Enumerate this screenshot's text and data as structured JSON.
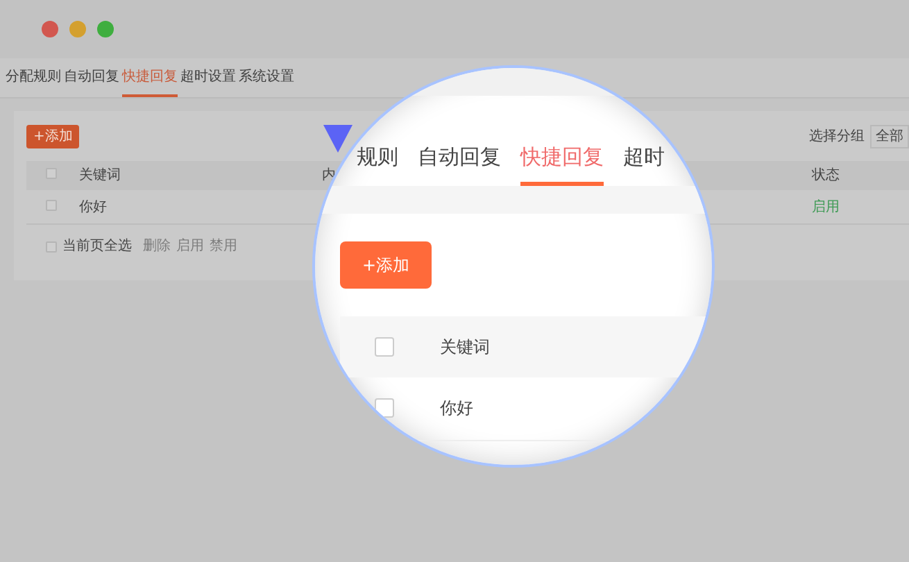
{
  "window": {
    "traffic_lights": [
      {
        "color": "#d2574f"
      },
      {
        "color": "#d4a02f"
      },
      {
        "color": "#3fae3f"
      }
    ]
  },
  "tabs": [
    {
      "label": "分配规则",
      "selected": false
    },
    {
      "label": "自动回复",
      "selected": false
    },
    {
      "label": "快捷回复",
      "selected": true
    },
    {
      "label": "超时设置",
      "selected": false
    },
    {
      "label": "系统设置",
      "selected": false
    }
  ],
  "toolbar": {
    "add_button": "+添加",
    "group_label": "选择分组",
    "group_select": "全部"
  },
  "table": {
    "header_checked": false,
    "columns": [
      {
        "label": "关键词"
      },
      {
        "label": "内"
      },
      {
        "label": "状态"
      }
    ],
    "rows": [
      {
        "checked": false,
        "keyword": "你好",
        "status": "启用"
      }
    ]
  },
  "footer": {
    "checked": false,
    "select_all": "当前页全选",
    "actions": [
      "删除",
      "启用",
      "禁用"
    ]
  },
  "magnifier": {
    "tabs": [
      {
        "label": "规则",
        "selected": false
      },
      {
        "label": "自动回复",
        "selected": false
      },
      {
        "label": "快捷回复",
        "selected": true
      },
      {
        "label": "超时",
        "selected": false
      }
    ],
    "add_button": "+添加",
    "header_checked": false,
    "column": "关键词",
    "row_checked": false,
    "row": "你好"
  }
}
